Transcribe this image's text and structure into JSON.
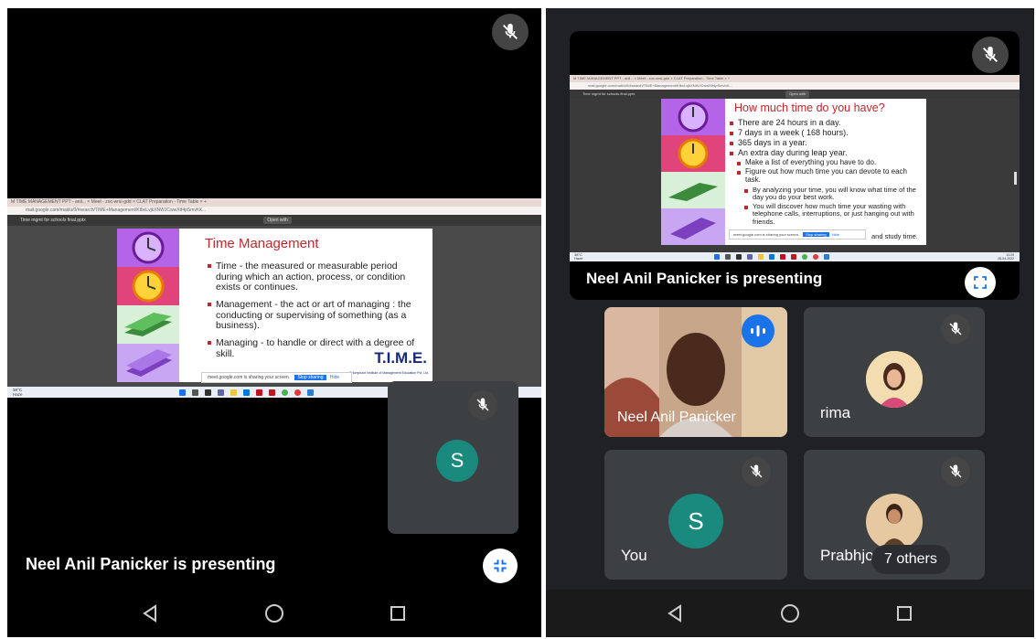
{
  "left": {
    "browser": {
      "tabs_text": "M  TIME MANAGEMENT PPT - anil...  ×   Meet - zoc-wrsi-gdd   ×   CLAT Preparation - Time Table  ×  +",
      "url": "mail.google.com/mail/u/0/#search/TIME+Management/KtbxLvjkXNWJCwwXtf4pSmvhX..."
    },
    "viewer": {
      "file_name": "Time mgmt for schools final.pptx",
      "open_with": "Open with"
    },
    "slide": {
      "title": "Time Management",
      "bullets": [
        "Time - the measured or measurable period during which an action, process, or condition exists or continues.",
        "Management - the act or art of managing : the conducting or supervising of something (as a business).",
        "Managing - to handle or direct with a degree of skill."
      ],
      "logo_text": "T.I.M.E.",
      "logo_sub": "Triumphant Institute of Management Education Pvt. Ltd."
    },
    "sharing_bar": {
      "text": "meet.google.com is sharing your screen.",
      "stop": "Stop sharing",
      "hide": "Hide"
    },
    "taskbar": {
      "weather_temp": "38°C",
      "weather_desc": "Haze"
    },
    "self_tile": {
      "avatar_letter": "S",
      "avatar_color": "#1a8a7e"
    },
    "presenting_text": "Neel Anil Panicker is presenting"
  },
  "right": {
    "slide": {
      "title": "How much time do you have?",
      "bullets": [
        "There are 24 hours in a day.",
        "7 days in a week ( 168 hours).",
        "365 days in a year.",
        "An extra day during leap year."
      ],
      "sub_bullets": [
        "Make a list of everything you have to do.",
        "Figure out how much time you can devote to each task."
      ],
      "sub_sub_bullets": [
        "By analyzing your time, you will know what time of the day you do your best work.",
        "You will discover how much time your wasting with telephone calls, interruptions, or just hanging out with friends.",
        "and study time."
      ]
    },
    "taskbar": {
      "weather_temp": "38°C",
      "weather_desc": "Haze",
      "time": "13:20",
      "date": "28-04-2022"
    },
    "presenting_text": "Neel Anil Panicker is presenting",
    "tiles": [
      {
        "name": "Neel Anil Panicker"
      },
      {
        "name": "rima"
      },
      {
        "name": "You",
        "avatar_letter": "S",
        "avatar_color": "#1a8a7e"
      },
      {
        "name": "Prabhjot",
        "others": "7 others"
      }
    ]
  }
}
